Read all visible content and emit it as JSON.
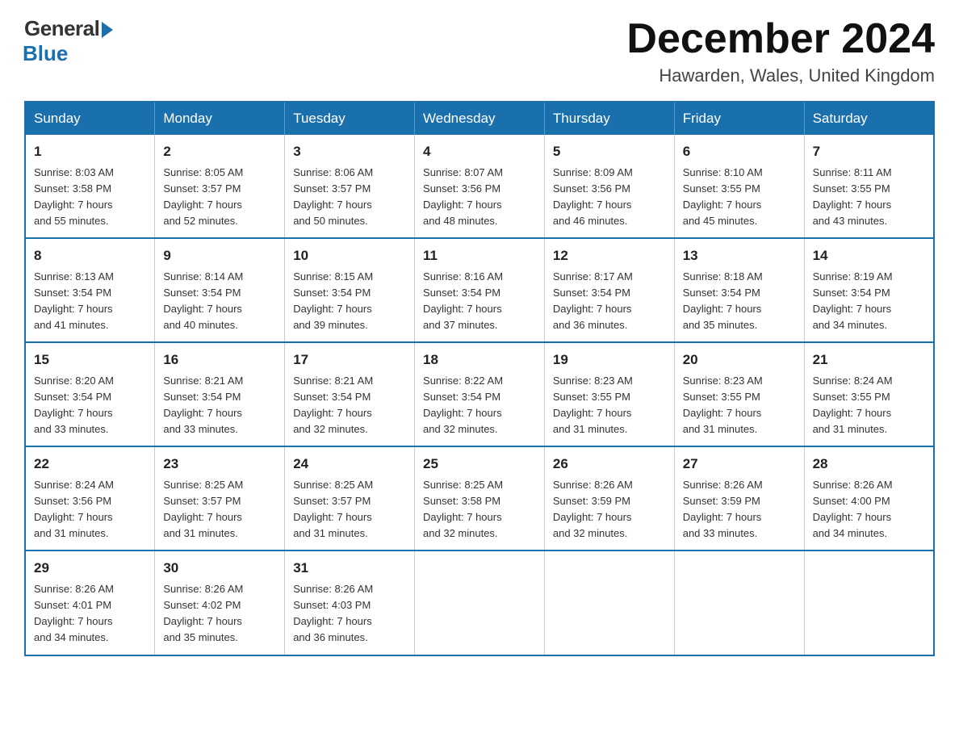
{
  "logo": {
    "general": "General",
    "blue": "Blue"
  },
  "title": "December 2024",
  "location": "Hawarden, Wales, United Kingdom",
  "days_of_week": [
    "Sunday",
    "Monday",
    "Tuesday",
    "Wednesday",
    "Thursday",
    "Friday",
    "Saturday"
  ],
  "weeks": [
    [
      {
        "day": "1",
        "sunrise": "8:03 AM",
        "sunset": "3:58 PM",
        "daylight": "7 hours and 55 minutes."
      },
      {
        "day": "2",
        "sunrise": "8:05 AM",
        "sunset": "3:57 PM",
        "daylight": "7 hours and 52 minutes."
      },
      {
        "day": "3",
        "sunrise": "8:06 AM",
        "sunset": "3:57 PM",
        "daylight": "7 hours and 50 minutes."
      },
      {
        "day": "4",
        "sunrise": "8:07 AM",
        "sunset": "3:56 PM",
        "daylight": "7 hours and 48 minutes."
      },
      {
        "day": "5",
        "sunrise": "8:09 AM",
        "sunset": "3:56 PM",
        "daylight": "7 hours and 46 minutes."
      },
      {
        "day": "6",
        "sunrise": "8:10 AM",
        "sunset": "3:55 PM",
        "daylight": "7 hours and 45 minutes."
      },
      {
        "day": "7",
        "sunrise": "8:11 AM",
        "sunset": "3:55 PM",
        "daylight": "7 hours and 43 minutes."
      }
    ],
    [
      {
        "day": "8",
        "sunrise": "8:13 AM",
        "sunset": "3:54 PM",
        "daylight": "7 hours and 41 minutes."
      },
      {
        "day": "9",
        "sunrise": "8:14 AM",
        "sunset": "3:54 PM",
        "daylight": "7 hours and 40 minutes."
      },
      {
        "day": "10",
        "sunrise": "8:15 AM",
        "sunset": "3:54 PM",
        "daylight": "7 hours and 39 minutes."
      },
      {
        "day": "11",
        "sunrise": "8:16 AM",
        "sunset": "3:54 PM",
        "daylight": "7 hours and 37 minutes."
      },
      {
        "day": "12",
        "sunrise": "8:17 AM",
        "sunset": "3:54 PM",
        "daylight": "7 hours and 36 minutes."
      },
      {
        "day": "13",
        "sunrise": "8:18 AM",
        "sunset": "3:54 PM",
        "daylight": "7 hours and 35 minutes."
      },
      {
        "day": "14",
        "sunrise": "8:19 AM",
        "sunset": "3:54 PM",
        "daylight": "7 hours and 34 minutes."
      }
    ],
    [
      {
        "day": "15",
        "sunrise": "8:20 AM",
        "sunset": "3:54 PM",
        "daylight": "7 hours and 33 minutes."
      },
      {
        "day": "16",
        "sunrise": "8:21 AM",
        "sunset": "3:54 PM",
        "daylight": "7 hours and 33 minutes."
      },
      {
        "day": "17",
        "sunrise": "8:21 AM",
        "sunset": "3:54 PM",
        "daylight": "7 hours and 32 minutes."
      },
      {
        "day": "18",
        "sunrise": "8:22 AM",
        "sunset": "3:54 PM",
        "daylight": "7 hours and 32 minutes."
      },
      {
        "day": "19",
        "sunrise": "8:23 AM",
        "sunset": "3:55 PM",
        "daylight": "7 hours and 31 minutes."
      },
      {
        "day": "20",
        "sunrise": "8:23 AM",
        "sunset": "3:55 PM",
        "daylight": "7 hours and 31 minutes."
      },
      {
        "day": "21",
        "sunrise": "8:24 AM",
        "sunset": "3:55 PM",
        "daylight": "7 hours and 31 minutes."
      }
    ],
    [
      {
        "day": "22",
        "sunrise": "8:24 AM",
        "sunset": "3:56 PM",
        "daylight": "7 hours and 31 minutes."
      },
      {
        "day": "23",
        "sunrise": "8:25 AM",
        "sunset": "3:57 PM",
        "daylight": "7 hours and 31 minutes."
      },
      {
        "day": "24",
        "sunrise": "8:25 AM",
        "sunset": "3:57 PM",
        "daylight": "7 hours and 31 minutes."
      },
      {
        "day": "25",
        "sunrise": "8:25 AM",
        "sunset": "3:58 PM",
        "daylight": "7 hours and 32 minutes."
      },
      {
        "day": "26",
        "sunrise": "8:26 AM",
        "sunset": "3:59 PM",
        "daylight": "7 hours and 32 minutes."
      },
      {
        "day": "27",
        "sunrise": "8:26 AM",
        "sunset": "3:59 PM",
        "daylight": "7 hours and 33 minutes."
      },
      {
        "day": "28",
        "sunrise": "8:26 AM",
        "sunset": "4:00 PM",
        "daylight": "7 hours and 34 minutes."
      }
    ],
    [
      {
        "day": "29",
        "sunrise": "8:26 AM",
        "sunset": "4:01 PM",
        "daylight": "7 hours and 34 minutes."
      },
      {
        "day": "30",
        "sunrise": "8:26 AM",
        "sunset": "4:02 PM",
        "daylight": "7 hours and 35 minutes."
      },
      {
        "day": "31",
        "sunrise": "8:26 AM",
        "sunset": "4:03 PM",
        "daylight": "7 hours and 36 minutes."
      },
      null,
      null,
      null,
      null
    ]
  ],
  "labels": {
    "sunrise": "Sunrise:",
    "sunset": "Sunset:",
    "daylight": "Daylight:"
  }
}
